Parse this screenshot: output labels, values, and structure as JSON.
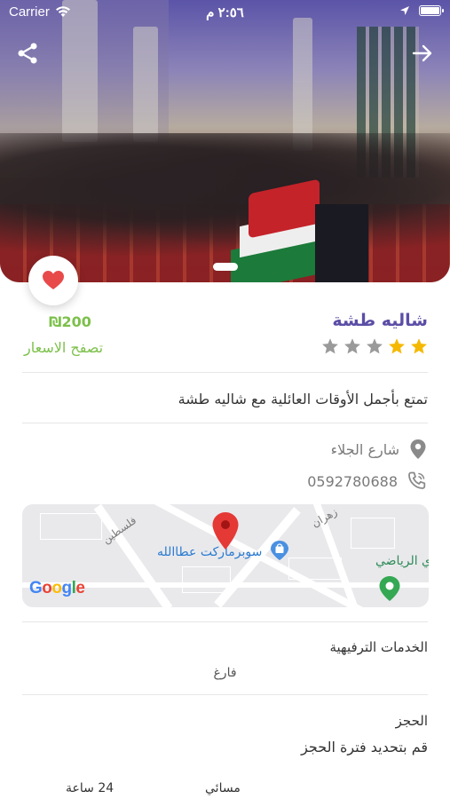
{
  "status_bar": {
    "carrier": "Carrier",
    "time": "٢:٥٦ م"
  },
  "listing": {
    "title": "شاليه طشة",
    "rating": 2,
    "rating_max": 5,
    "price": "₪200",
    "browse_prices": "تصفح الاسعار",
    "description": "تمتع بأجمل الأوقات العائلية مع شاليه طشة",
    "address": "شارع الجلاء",
    "phone": "0592780688"
  },
  "map": {
    "poi": "سوبرماركت عطاالله",
    "street_1": "فلسطين",
    "street_2": "زهران",
    "place_right": "ي الرياضي",
    "logo": "Google"
  },
  "amenities": {
    "title": "الخدمات الترفيهية",
    "value": "فارغ"
  },
  "booking": {
    "title": "الحجز",
    "subtitle": "قم بتحديد فترة الحجز",
    "option_evening": "مسائي",
    "option_24h": "24 ساعة"
  },
  "colors": {
    "accent": "#5b4ea6",
    "price_green": "#7cc04b",
    "star_gold": "#f5b800",
    "star_gray": "#9a9a9a",
    "heart": "#e84a4a",
    "pin_red": "#e53935"
  }
}
